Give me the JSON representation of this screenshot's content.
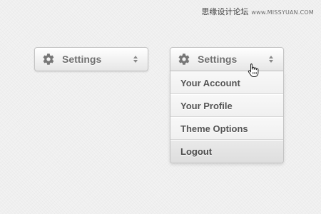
{
  "watermark": {
    "chinese": "思缘设计论坛",
    "url": "www.MISSYUAN.COM"
  },
  "dropdown_closed": {
    "label": "Settings",
    "icon": "gear-icon",
    "expanded": false
  },
  "dropdown_open": {
    "label": "Settings",
    "icon": "gear-icon",
    "expanded": true
  },
  "menu": {
    "items": [
      {
        "label": "Your Account"
      },
      {
        "label": "Your Profile"
      },
      {
        "label": "Theme Options"
      },
      {
        "label": "Logout"
      }
    ],
    "hovered_item": "Logout"
  },
  "cursor": {
    "icon": "hand-pointer-icon"
  },
  "colors": {
    "background": "#f2f2f2",
    "button_text": "#707070",
    "menu_text": "#555555",
    "icon": "#777777"
  }
}
